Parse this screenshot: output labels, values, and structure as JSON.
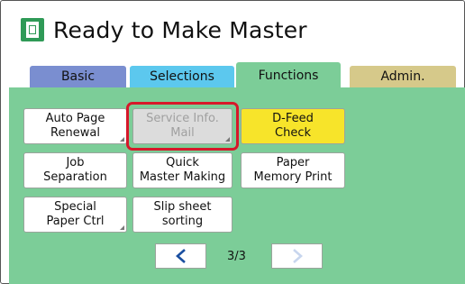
{
  "header": {
    "title": "Ready to Make Master",
    "icon": "master-icon"
  },
  "tabs": [
    {
      "label": "Basic",
      "color": "#7a8ed0"
    },
    {
      "label": "Selections",
      "color": "#5cc8ee"
    },
    {
      "label": "Functions",
      "color": "#7ccd98",
      "active": true
    },
    {
      "label": "Admin.",
      "color": "#d6c98a"
    }
  ],
  "functions": {
    "auto_page_renewal": "Auto Page\nRenewal",
    "service_info_mail": "Service Info.\nMail",
    "d_feed_check": "D-Feed\nCheck",
    "job_separation": "Job\nSeparation",
    "quick_master_making": "Quick\nMaster Making",
    "paper_memory_print": "Paper\nMemory Print",
    "special_paper_ctrl": "Special\nPaper Ctrl",
    "slip_sheet_sorting": "Slip sheet\nsorting"
  },
  "pagination": {
    "page": "3/3",
    "prev_icon": "chevron-left-icon",
    "next_icon": "chevron-right-icon"
  },
  "colors": {
    "panel": "#7ccd98",
    "highlight": "#d6182a",
    "active_button": "#f7e42a"
  }
}
